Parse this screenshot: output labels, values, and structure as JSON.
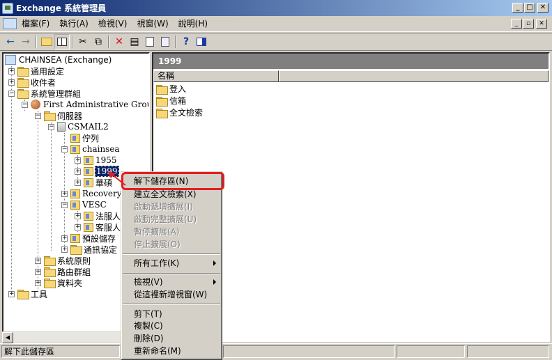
{
  "window": {
    "title": "Exchange 系統管理員",
    "min": "_",
    "max": "□",
    "close": "✕"
  },
  "menu": [
    "檔案(F)",
    "執行(A)",
    "檢視(V)",
    "視窗(W)",
    "說明(H)"
  ],
  "mdi": {
    "min": "_",
    "restore": "▫",
    "close": "✕"
  },
  "toolbar": {
    "back": "←",
    "forward": "→",
    "cut": "✂",
    "copy": "⧉",
    "delete": "✕",
    "props": "▤",
    "help": "?"
  },
  "tree": {
    "root": "CHAINSEA (Exchange)",
    "global": "通用設定",
    "recipients": "收件者",
    "admin_groups": "系統管理群組",
    "first_group": "First Administrative Group",
    "servers": "伺服器",
    "csmail2": "CSMAIL2",
    "queues": "佇列",
    "chainsea": "chainsea",
    "s1955": "1955",
    "s1999": "1999",
    "s_hua": "華碩",
    "recovery": "Recovery",
    "vesc": "VESC",
    "legal": "法服人",
    "cust": "客服人",
    "default_store": "預設儲存",
    "protocols": "通訊協定",
    "policies": "系統原則",
    "routing": "路由群組",
    "folders": "資料夾",
    "tools": "工具"
  },
  "right": {
    "title": "1999",
    "col_name": "名稱",
    "items": [
      "登入",
      "信箱",
      "全文檢索"
    ]
  },
  "context_menu": {
    "dismount": "解下儲存區(N)",
    "create_index": "建立全文檢索(X)",
    "start_incremental": "啟動遞增擴展(I)",
    "start_full": "啟動完整擴展(U)",
    "pause": "暫停擴展(A)",
    "stop": "停止擴展(O)",
    "all_tasks": "所有工作(K)",
    "view": "檢視(V)",
    "new_window": "從這裡新增視窗(W)",
    "cut": "剪下(T)",
    "copy": "複製(C)",
    "delete": "刪除(D)",
    "rename": "重新命名(M)"
  },
  "status": {
    "text": "解下此儲存區"
  },
  "colors": {
    "highlight": "#e02020",
    "selection": "#0a246a"
  }
}
